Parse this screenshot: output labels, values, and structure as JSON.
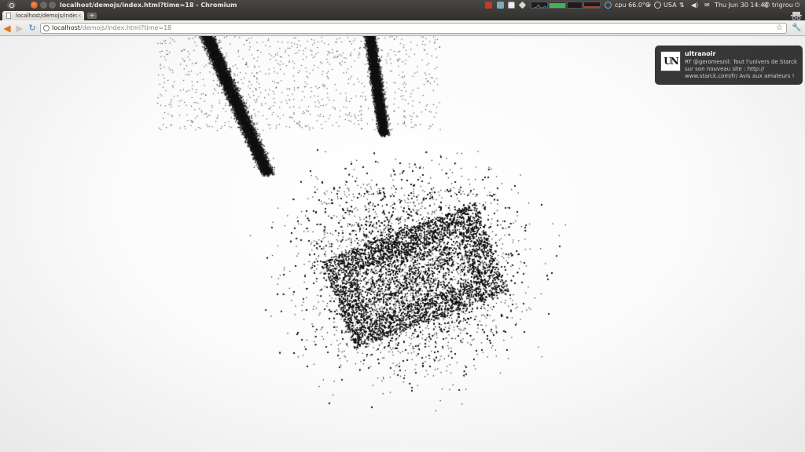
{
  "window": {
    "title": "localhost/demojs/index.html?time=18 - Chromium"
  },
  "panel": {
    "cpu": "cpu 66.0°C",
    "keyboard": "USA",
    "datetime": "Thu Jun 30 14:44",
    "user": "trigrou",
    "icons": [
      "ubuntu-logo-icon",
      "mail-warning-icon",
      "clipboard-icon",
      "checkbox-icon",
      "dropbox-icon",
      "system-monitor-graph",
      "network-icon",
      "bluetooth-icon",
      "sync-icon",
      "volume-icon",
      "mail-icon",
      "user-icon",
      "power-icon"
    ]
  },
  "tabs": [
    {
      "label": "localhost/demojs/index.htm",
      "close": "×"
    }
  ],
  "new_tab_label": "+",
  "toolbar": {
    "url_host": "localhost",
    "url_path": "/demojs/index.html?time=18"
  },
  "notification": {
    "avatar_text": "UN",
    "title": "ultranoir",
    "body": "RT @geromesnil: Tout l'univers de Starck sur son nouveau site : http:// www.starck.com/fr/ Avis aux amateurs !"
  },
  "colors": {
    "accent_orange": "#e0731f",
    "reload_blue": "#3f7fc4",
    "panel_bg": "#3b3a36",
    "particles": "#111111"
  }
}
